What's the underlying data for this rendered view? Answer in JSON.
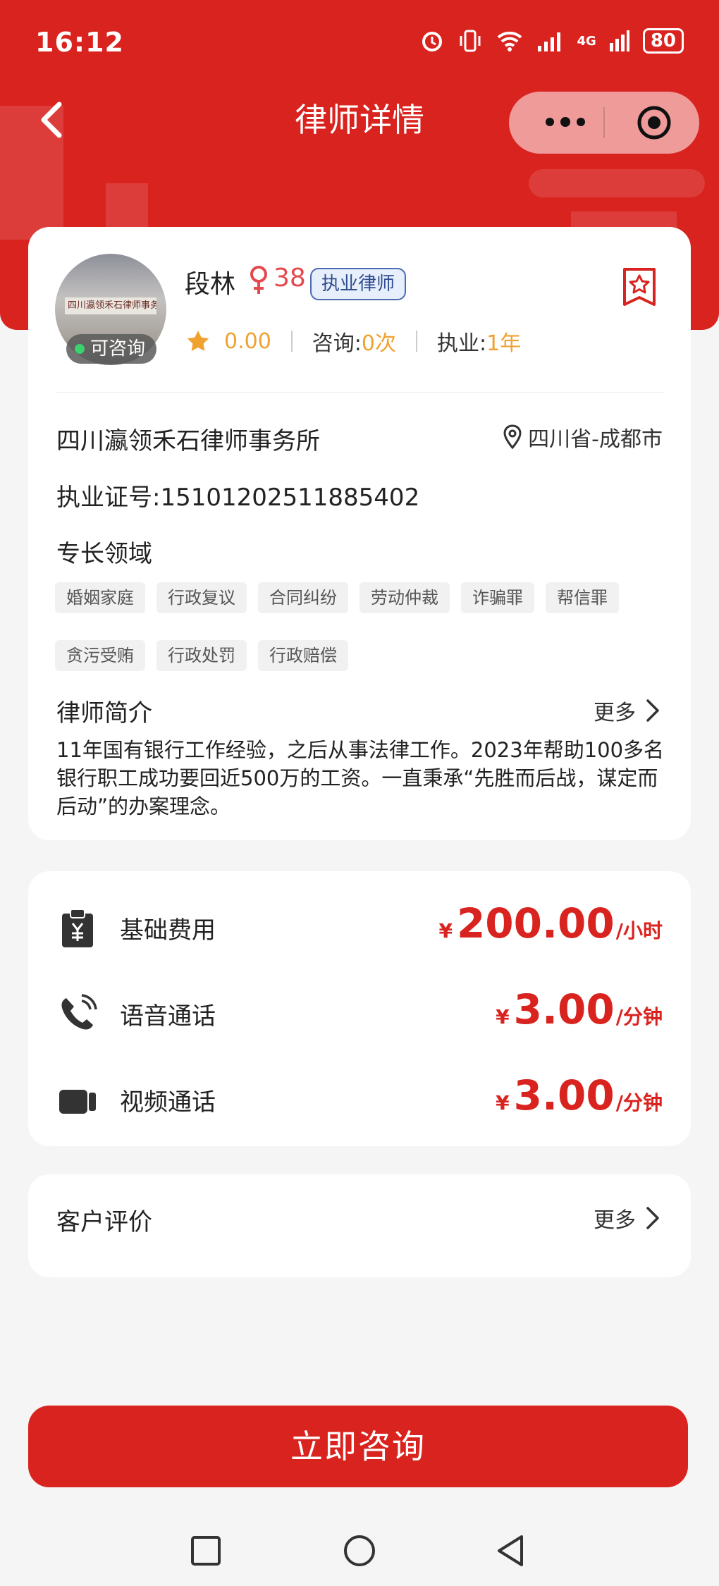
{
  "status_bar": {
    "time": "16:12",
    "network": "4G",
    "battery": "80"
  },
  "nav": {
    "title": "律师详情"
  },
  "lawyer": {
    "name": "段林",
    "age": "38",
    "license_tag": "执业律师",
    "status": "可咨询",
    "rating": "0.00",
    "consult_label": "咨询:",
    "consult_value": "0次",
    "practice_label": "执业:",
    "practice_value": "1年",
    "firm": "四川瀛领禾石律师事务所",
    "location": "四川省-成都市",
    "certificate": "执业证号:15101202511885402",
    "avatar_sign_text": "四川瀛领禾石律师事务所"
  },
  "specialty": {
    "title": "专长领域",
    "tags": [
      "婚姻家庭",
      "行政复议",
      "合同纠纷",
      "劳动仲裁",
      "诈骗罪",
      "帮信罪",
      "贪污受贿",
      "行政处罚",
      "行政赔偿"
    ]
  },
  "intro": {
    "title": "律师简介",
    "more": "更多",
    "text": "11年国有银行工作经验，之后从事法律工作。2023年帮助100多名银行职工成功要回近500万的工资。一直秉承“先胜而后战，谋定而后动”的办案理念。"
  },
  "fees": [
    {
      "icon": "fee-clipboard-icon",
      "label": "基础费用",
      "currency": "¥",
      "amount": "200.00",
      "unit": "/小时"
    },
    {
      "icon": "phone-icon",
      "label": "语音通话",
      "currency": "¥",
      "amount": "3.00",
      "unit": "/分钟"
    },
    {
      "icon": "video-camera-icon",
      "label": "视频通话",
      "currency": "¥",
      "amount": "3.00",
      "unit": "/分钟"
    }
  ],
  "reviews": {
    "title": "客户评价",
    "more": "更多"
  },
  "cta": {
    "label": "立即咨询"
  },
  "colors": {
    "brand_red": "#d9231f",
    "accent_orange": "#f0a230",
    "female_pink": "#e5484d",
    "tag_blue": "#2e4c8f"
  }
}
